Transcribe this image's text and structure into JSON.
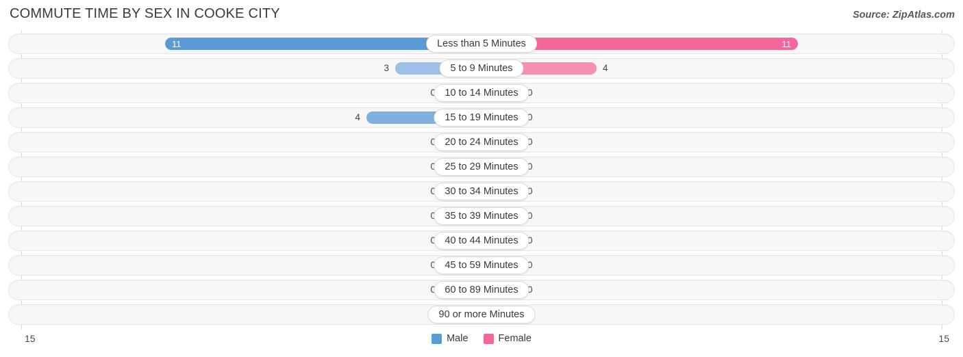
{
  "header": {
    "title": "COMMUTE TIME BY SEX IN COOKE CITY",
    "source": "Source: ZipAtlas.com"
  },
  "axis": {
    "left_label": "15",
    "right_label": "15",
    "max": 15
  },
  "legend": {
    "items": [
      {
        "label": "Male",
        "color": "#5b9bd5"
      },
      {
        "label": "Female",
        "color": "#f4679a"
      }
    ]
  },
  "colors": {
    "male_strong": "#5b9bd5",
    "male_mid": "#7fb0de",
    "male_light": "#9cc0e8",
    "female_strong": "#f4679a",
    "female_mid": "#f78fb3",
    "female_light": "#f9a2c0",
    "track": "#f7f7f7",
    "track_border": "#e6e6e6"
  },
  "chart_data": {
    "type": "bar",
    "title": "COMMUTE TIME BY SEX IN COOKE CITY",
    "subtitle": "",
    "xlabel": "",
    "ylabel": "",
    "orientation": "horizontal-diverging",
    "xlim": [
      15,
      15
    ],
    "grid": false,
    "legend_position": "bottom-center",
    "categories": [
      "Less than 5 Minutes",
      "5 to 9 Minutes",
      "10 to 14 Minutes",
      "15 to 19 Minutes",
      "20 to 24 Minutes",
      "25 to 29 Minutes",
      "30 to 34 Minutes",
      "35 to 39 Minutes",
      "40 to 44 Minutes",
      "45 to 59 Minutes",
      "60 to 89 Minutes",
      "90 or more Minutes"
    ],
    "series": [
      {
        "name": "Male",
        "values": [
          11,
          3,
          0,
          4,
          0,
          0,
          0,
          0,
          0,
          0,
          0,
          0
        ]
      },
      {
        "name": "Female",
        "values": [
          11,
          4,
          0,
          0,
          0,
          0,
          0,
          0,
          0,
          0,
          0,
          0
        ]
      }
    ]
  },
  "rows": [
    {
      "label": "Less than 5 Minutes",
      "male": "11",
      "female": "11"
    },
    {
      "label": "5 to 9 Minutes",
      "male": "3",
      "female": "4"
    },
    {
      "label": "10 to 14 Minutes",
      "male": "0",
      "female": "0"
    },
    {
      "label": "15 to 19 Minutes",
      "male": "4",
      "female": "0"
    },
    {
      "label": "20 to 24 Minutes",
      "male": "0",
      "female": "0"
    },
    {
      "label": "25 to 29 Minutes",
      "male": "0",
      "female": "0"
    },
    {
      "label": "30 to 34 Minutes",
      "male": "0",
      "female": "0"
    },
    {
      "label": "35 to 39 Minutes",
      "male": "0",
      "female": "0"
    },
    {
      "label": "40 to 44 Minutes",
      "male": "0",
      "female": "0"
    },
    {
      "label": "45 to 59 Minutes",
      "male": "0",
      "female": "0"
    },
    {
      "label": "60 to 89 Minutes",
      "male": "0",
      "female": "0"
    },
    {
      "label": "90 or more Minutes",
      "male": "0",
      "female": "0"
    }
  ]
}
